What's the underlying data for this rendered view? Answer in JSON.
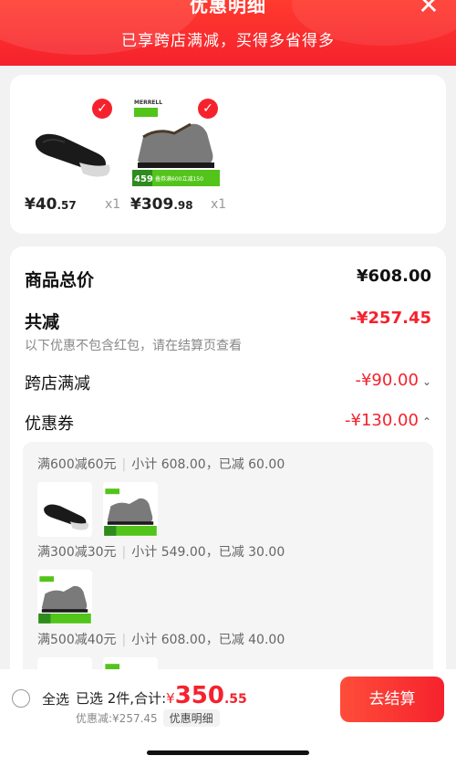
{
  "header": {
    "title": "优惠明细",
    "subtitle": "已享跨店满减，买得多省得多",
    "close_icon": "close-icon"
  },
  "products": [
    {
      "name": "black no-show socks",
      "price_int": "¥40",
      "price_dec": ".57",
      "qty": "x1",
      "selected": true
    },
    {
      "name": "MERRELL grey hiking shoe",
      "price_int": "¥309",
      "price_dec": ".98",
      "qty": "x1",
      "selected": true,
      "brand": "MERRELL",
      "promo_badge_price": "459",
      "promo_badge_text": "叠券满600立减150"
    }
  ],
  "breakdown": {
    "total_label": "商品总价",
    "total_value": "¥608.00",
    "reduce_label": "共减",
    "reduce_value": "-¥257.45",
    "note": "以下优惠不包含红包，请在结算页查看",
    "cross_store_label": "跨店满减",
    "cross_store_value": "-¥90.00",
    "coupon_label": "优惠券",
    "coupon_value": "-¥130.00"
  },
  "coupon_rules": [
    {
      "rule": "满600减60元",
      "subtotal": "小计 608.00，已减 60.00"
    },
    {
      "rule": "满300减30元",
      "subtotal": "小计 549.00，已减 30.00"
    },
    {
      "rule": "满500减40元",
      "subtotal": "小计 608.00，已减 40.00"
    }
  ],
  "bottom": {
    "select_all": "全选",
    "summary_prefix": "已选 2件,合计:",
    "total_symbol": "¥",
    "total_int": "350",
    "total_dec": ".55",
    "discount_line": "优惠减:¥257.45",
    "detail_tag": "优惠明细",
    "checkout": "去结算"
  },
  "colors": {
    "accent": "#f5222d",
    "promo_green": "#52c41a"
  }
}
